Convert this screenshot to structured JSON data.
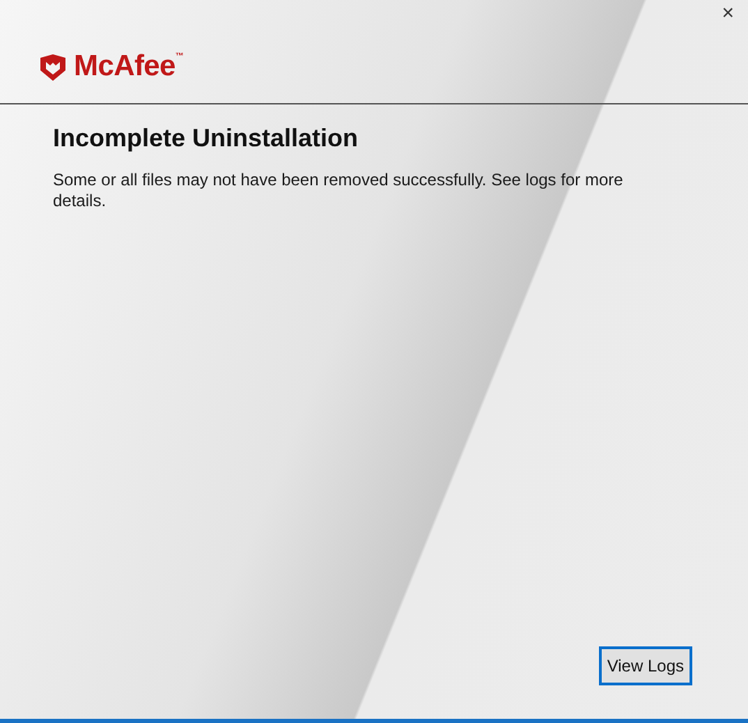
{
  "logo": {
    "text": "McAfee",
    "trademark": "™"
  },
  "close_button": {
    "label": "×"
  },
  "title": "Incomplete Uninstallation",
  "message": "Some or all files may not have been removed successfully. See logs for more details.",
  "buttons": [
    {
      "label": "View Logs",
      "focused": true
    }
  ]
}
